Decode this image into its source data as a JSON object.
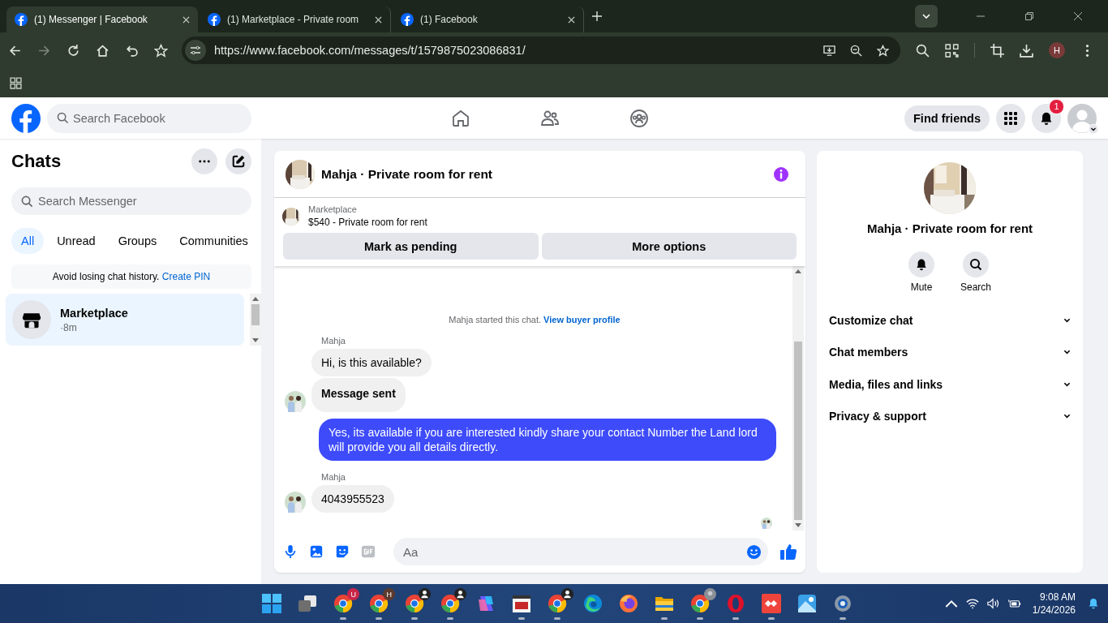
{
  "browser": {
    "tabs": [
      {
        "title": "(1) Messenger | Facebook",
        "selected": true
      },
      {
        "title": "(1) Marketplace - Private room",
        "selected": false
      },
      {
        "title": "(1) Facebook",
        "selected": false
      }
    ],
    "url": "https://www.facebook.com/messages/t/1579875023086831/",
    "profile_initial": "H"
  },
  "facebook": {
    "search_placeholder": "Search Facebook",
    "find_friends": "Find friends",
    "notification_count": "1"
  },
  "chats": {
    "title": "Chats",
    "search_placeholder": "Search Messenger",
    "filters": [
      {
        "label": "All",
        "selected": true
      },
      {
        "label": "Unread",
        "selected": false
      },
      {
        "label": "Groups",
        "selected": false
      },
      {
        "label": "Communities",
        "selected": false
      }
    ],
    "pin_notice": {
      "text": "Avoid losing chat history.",
      "link": "Create PIN"
    },
    "conversations": [
      {
        "name": "Marketplace",
        "time": "·8m",
        "selected": true
      }
    ]
  },
  "conversation": {
    "title": "Mahja · Private room for rent",
    "listing": {
      "source": "Marketplace",
      "title": "$540 - Private room for rent"
    },
    "buttons": [
      "Mark as pending",
      "More options"
    ],
    "system_message": {
      "text": "Mahja started this chat.",
      "link": "View buyer profile"
    },
    "groups": [
      {
        "kind": "incoming",
        "sender": "Mahja",
        "bubbles": [
          {
            "text": "Hi, is this available?",
            "bold": false
          },
          {
            "text": "Message sent",
            "bold": true
          }
        ]
      },
      {
        "kind": "outgoing",
        "bubbles": [
          {
            "text": "Yes, its available if you are interested kindly share your contact Number the Land lord will provide you all details directly.",
            "bold": false
          }
        ]
      },
      {
        "kind": "incoming",
        "sender": "Mahja",
        "bubbles": [
          {
            "text": "4043955523",
            "bold": false
          }
        ]
      }
    ],
    "composer_placeholder": "Aa"
  },
  "details": {
    "name": "Mahja · Private room for rent",
    "actions": [
      {
        "kind": "mute",
        "label": "Mute"
      },
      {
        "kind": "search",
        "label": "Search"
      }
    ],
    "sections": [
      {
        "label": "Customize chat",
        "expanded": false
      },
      {
        "label": "Chat members",
        "expanded": false
      },
      {
        "label": "Media, files and links",
        "expanded": false
      },
      {
        "label": "Privacy & support",
        "expanded": false
      }
    ]
  },
  "taskbar": {
    "apps": [
      {
        "kind": "start",
        "running": false
      },
      {
        "kind": "taskview",
        "running": false
      },
      {
        "kind": "chrome",
        "running": true,
        "badge": {
          "kind": "letter",
          "text": "U",
          "color": "#c8264a"
        }
      },
      {
        "kind": "chrome",
        "running": true,
        "badge": {
          "kind": "letter",
          "text": "H",
          "color": "#5b3a2e"
        }
      },
      {
        "kind": "chrome",
        "running": true,
        "badge": {
          "kind": "person"
        }
      },
      {
        "kind": "chrome",
        "running": true,
        "badge": {
          "kind": "person"
        }
      },
      {
        "kind": "copilot",
        "running": false
      },
      {
        "kind": "media",
        "running": true
      },
      {
        "kind": "chrome",
        "running": true,
        "badge": {
          "kind": "person"
        }
      },
      {
        "kind": "edge",
        "running": false
      },
      {
        "kind": "firefox",
        "running": false
      },
      {
        "kind": "files",
        "running": true
      },
      {
        "kind": "chrome",
        "running": true
      },
      {
        "kind": "opera",
        "running": true
      },
      {
        "kind": "anydesk",
        "running": true
      },
      {
        "kind": "photos",
        "running": false
      },
      {
        "kind": "settings",
        "running": true
      }
    ],
    "time": "9:08 AM",
    "date": "1/24/2026"
  }
}
